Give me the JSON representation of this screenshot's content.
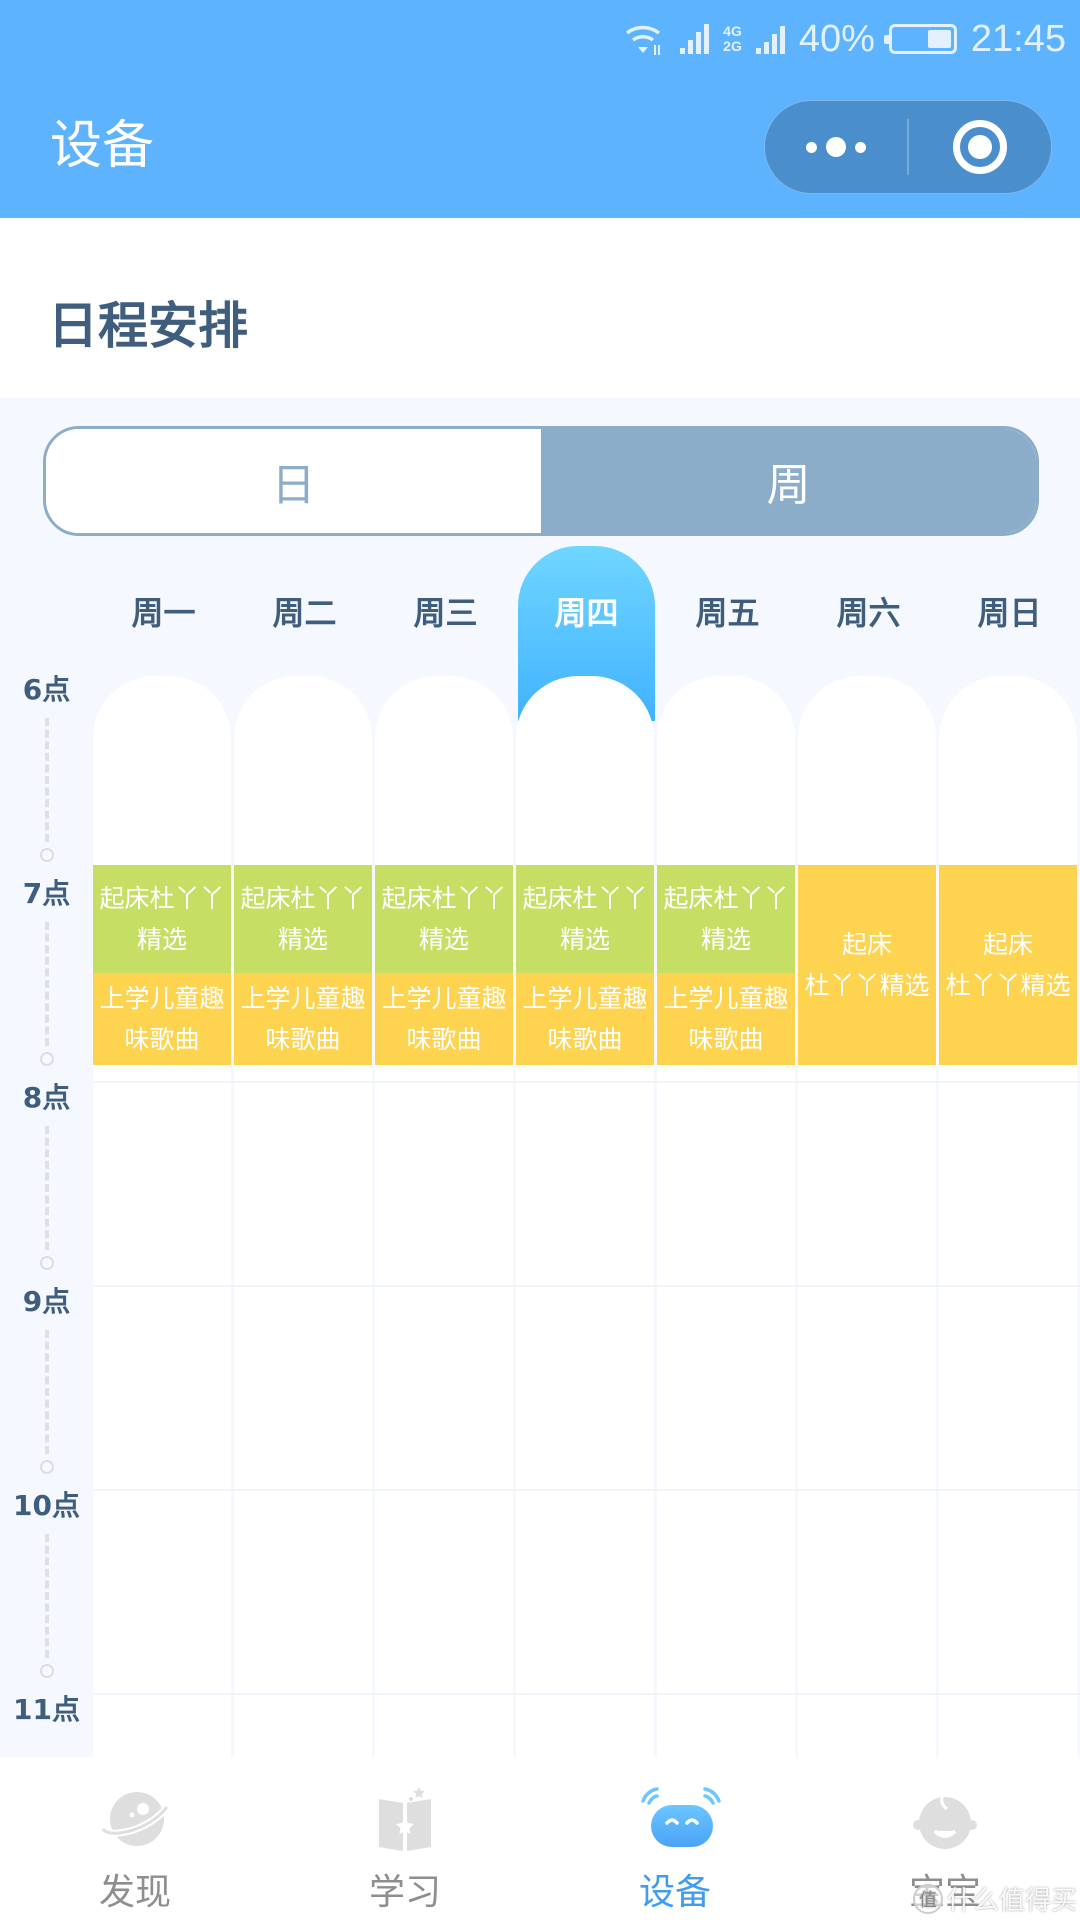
{
  "status_bar": {
    "battery_percent": "40%",
    "battery_level": 0.4,
    "time": "21:45",
    "network_top": "4G",
    "network_bottom": "2G"
  },
  "header": {
    "title": "设备",
    "more_icon": "more-dots-icon",
    "close_icon": "target-circle-icon"
  },
  "page": {
    "title": "日程安排"
  },
  "view_toggle": {
    "options": [
      "日",
      "周"
    ],
    "selected": "周"
  },
  "week": {
    "days": [
      "周一",
      "周二",
      "周三",
      "周四",
      "周五",
      "周六",
      "周日"
    ],
    "active_day_index": 3
  },
  "hours": [
    "6点",
    "7点",
    "8点",
    "9点",
    "10点",
    "11点"
  ],
  "events": [
    {
      "day": 0,
      "start": 7.0,
      "end": 7.53,
      "title": "起床杜丫丫精选",
      "lines": [
        "起床杜丫丫",
        "精选"
      ],
      "color": "#c4df64"
    },
    {
      "day": 0,
      "start": 7.53,
      "end": 7.98,
      "title": "上学儿童趣味歌曲",
      "lines": [
        "上学儿童趣",
        "味歌曲"
      ],
      "color": "#fdd34f"
    },
    {
      "day": 1,
      "start": 7.0,
      "end": 7.53,
      "title": "起床杜丫丫精选",
      "lines": [
        "起床杜丫丫",
        "精选"
      ],
      "color": "#c4df64"
    },
    {
      "day": 1,
      "start": 7.53,
      "end": 7.98,
      "title": "上学儿童趣味歌曲",
      "lines": [
        "上学儿童趣",
        "味歌曲"
      ],
      "color": "#fdd34f"
    },
    {
      "day": 2,
      "start": 7.0,
      "end": 7.53,
      "title": "起床杜丫丫精选",
      "lines": [
        "起床杜丫丫",
        "精选"
      ],
      "color": "#c4df64"
    },
    {
      "day": 2,
      "start": 7.53,
      "end": 7.98,
      "title": "上学儿童趣味歌曲",
      "lines": [
        "上学儿童趣",
        "味歌曲"
      ],
      "color": "#fdd34f"
    },
    {
      "day": 3,
      "start": 7.0,
      "end": 7.53,
      "title": "起床杜丫丫精选",
      "lines": [
        "起床杜丫丫",
        "精选"
      ],
      "color": "#c4df64"
    },
    {
      "day": 3,
      "start": 7.53,
      "end": 7.98,
      "title": "上学儿童趣味歌曲",
      "lines": [
        "上学儿童趣",
        "味歌曲"
      ],
      "color": "#fdd34f"
    },
    {
      "day": 4,
      "start": 7.0,
      "end": 7.53,
      "title": "起床杜丫丫精选",
      "lines": [
        "起床杜丫丫",
        "精选"
      ],
      "color": "#c4df64"
    },
    {
      "day": 4,
      "start": 7.53,
      "end": 7.98,
      "title": "上学儿童趣味歌曲",
      "lines": [
        "上学儿童趣",
        "味歌曲"
      ],
      "color": "#fdd34f"
    },
    {
      "day": 5,
      "start": 7.0,
      "end": 7.98,
      "title": "起床杜丫丫精选",
      "lines": [
        "起床",
        "杜丫丫精选"
      ],
      "color": "#fdd34f"
    },
    {
      "day": 6,
      "start": 7.0,
      "end": 7.98,
      "title": "起床杜丫丫精选",
      "lines": [
        "起床",
        "杜丫丫精选"
      ],
      "color": "#fdd34f"
    }
  ],
  "tabbar": {
    "items": [
      {
        "label": "发现",
        "icon": "planet-icon",
        "active": false
      },
      {
        "label": "学习",
        "icon": "book-star-icon",
        "active": false
      },
      {
        "label": "设备",
        "icon": "robot-device-icon",
        "active": true
      },
      {
        "label": "宝宝",
        "icon": "baby-face-icon",
        "active": false
      }
    ]
  },
  "watermark": {
    "badge": "值",
    "text": "什么值得买"
  },
  "colors": {
    "header_bg": "#5eb3fe",
    "capsule_bg": "#4a8fcb",
    "title_text": "#3f5d7d",
    "toggle_accent": "#8badca",
    "active_day_gradient_top": "#6fd6ff",
    "active_day_gradient_bottom": "#42b2ff",
    "event_green": "#c4df64",
    "event_yellow": "#fdd34f",
    "tab_active": "#3f9cf0",
    "tab_inactive": "#8e8e8e"
  }
}
